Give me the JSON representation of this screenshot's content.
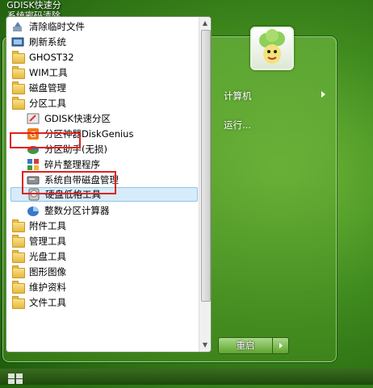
{
  "desktop": {
    "icon_label": "GDISK快速分 系统密码清除 区"
  },
  "left_menu": {
    "items": [
      {
        "label": "清除临时文件",
        "icon": "cleanup-icon"
      },
      {
        "label": "刷新系统",
        "icon": "refresh-system-icon"
      },
      {
        "label": "GHOST32",
        "icon": "folder-icon"
      },
      {
        "label": "WIM工具",
        "icon": "folder-icon"
      },
      {
        "label": "磁盘管理",
        "icon": "folder-icon"
      },
      {
        "label": "分区工具",
        "icon": "folder-icon"
      },
      {
        "label": "GDISK快速分区",
        "icon": "gdisk-icon"
      },
      {
        "label": "分区神器DiskGenius",
        "icon": "diskgenius-icon"
      },
      {
        "label": "分区助手(无损)",
        "icon": "partition-assistant-icon"
      },
      {
        "label": "碎片整理程序",
        "icon": "defrag-icon"
      },
      {
        "label": "系统自带磁盘管理",
        "icon": "disk-management-icon"
      },
      {
        "label": "硬盘低格工具",
        "icon": "low-format-icon"
      },
      {
        "label": "整数分区计算器",
        "icon": "calculator-icon"
      },
      {
        "label": "附件工具",
        "icon": "folder-icon"
      },
      {
        "label": "管理工具",
        "icon": "folder-icon"
      },
      {
        "label": "光盘工具",
        "icon": "folder-icon"
      },
      {
        "label": "图形图像",
        "icon": "folder-icon"
      },
      {
        "label": "维护资料",
        "icon": "folder-icon"
      },
      {
        "label": "文件工具",
        "icon": "folder-icon"
      }
    ]
  },
  "right_menu": {
    "computer": "计算机",
    "run": "运行..."
  },
  "shutdown": {
    "label": "重启"
  },
  "colors": {
    "highlight_box": "#e02020",
    "selection_bg": "#d6ecfa"
  }
}
